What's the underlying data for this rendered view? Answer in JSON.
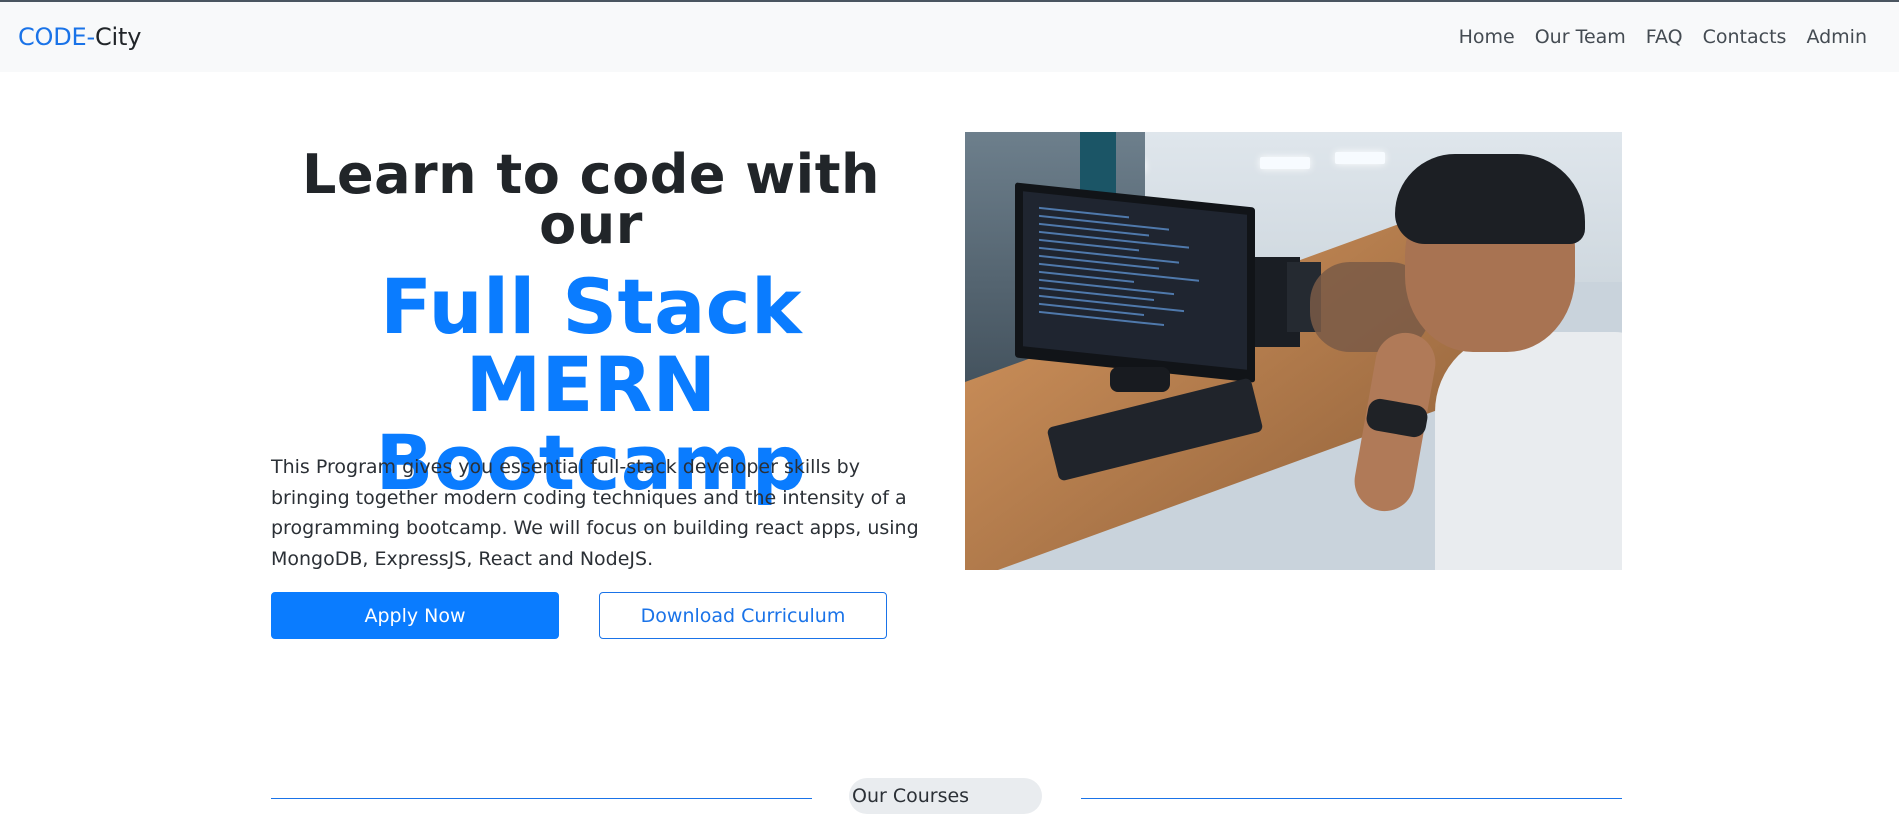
{
  "navbar": {
    "brand": {
      "code": "CODE",
      "dash": "-",
      "city": "City"
    },
    "links": [
      "Home",
      "Our Team",
      "FAQ",
      "Contacts",
      "Admin"
    ]
  },
  "hero": {
    "pre_title": "Learn to code with our",
    "main_title": "Full Stack MERN Bootcamp",
    "description": "This Program gives you essential full-stack developer skills by bringing together modern coding techniques and the intensity of a programming bootcamp. We will focus on building react apps, using MongoDB, ExpressJS, React and NodeJS.",
    "apply_button": "Apply Now",
    "download_button": "Download Curriculum"
  },
  "section": {
    "title": "Our Courses"
  },
  "colors": {
    "accent": "#0a7cff",
    "navbar_bg": "#f8f9fa",
    "text": "#212529"
  }
}
